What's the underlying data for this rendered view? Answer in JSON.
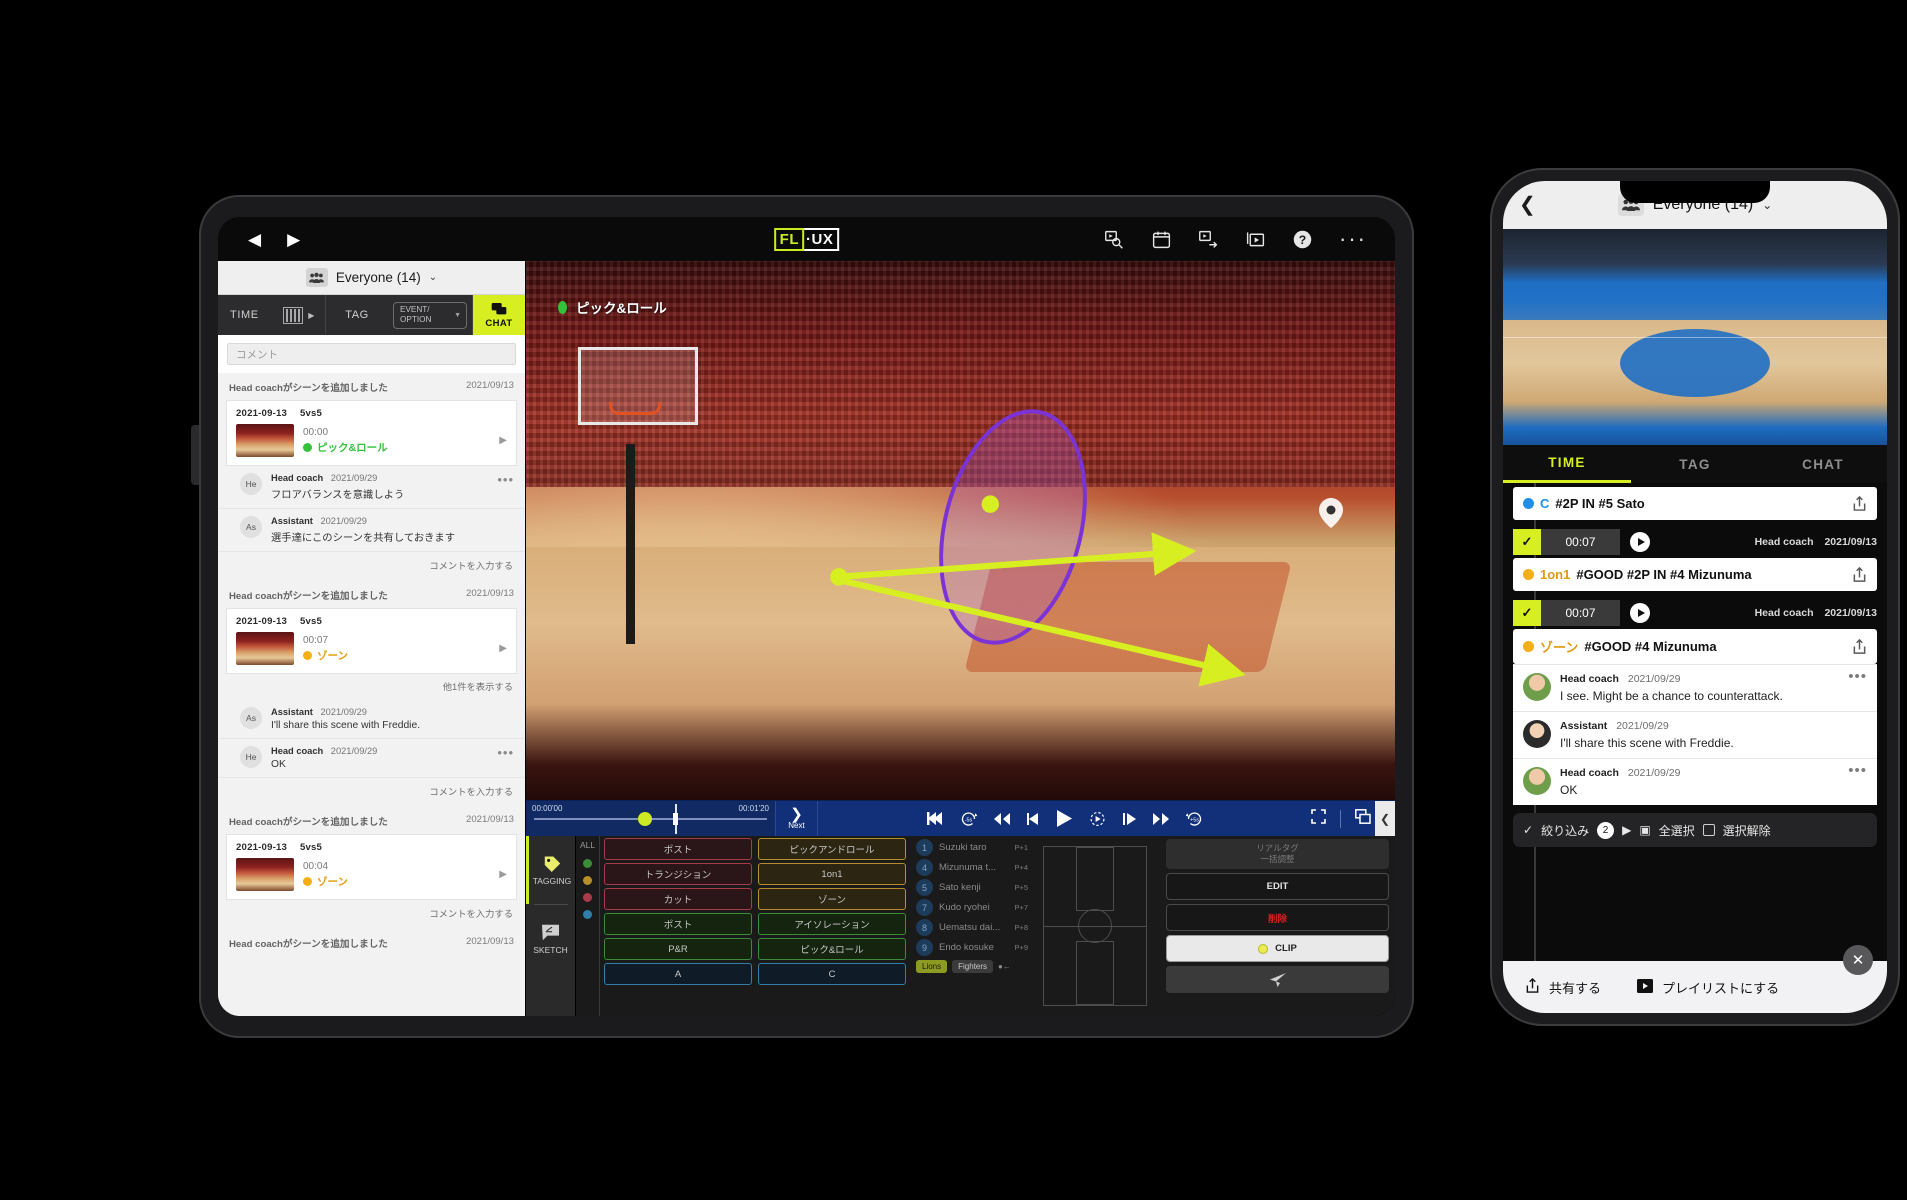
{
  "tablet": {
    "topbar": {
      "back_label": "◀",
      "forward_label": "▶",
      "logo_left": "FL",
      "logo_right": "·UX",
      "icons": [
        {
          "name": "video-search-icon",
          "glyph": "video-search"
        },
        {
          "name": "calendar-icon",
          "glyph": "calendar"
        },
        {
          "name": "video-export-icon",
          "glyph": "video-export"
        },
        {
          "name": "video-library-icon",
          "glyph": "video-library"
        },
        {
          "name": "help-icon",
          "glyph": "help"
        },
        {
          "name": "more-icon",
          "glyph": "···"
        }
      ]
    },
    "chat_panel": {
      "group_label": "Everyone (14)",
      "group_chevron": "⌄",
      "tabs": {
        "time": "TIME",
        "tag": "TAG",
        "event_option": "EVENT/\nOPTION",
        "event_option_line1": "EVENT/",
        "event_option_line2": "OPTION",
        "chat": "CHAT"
      },
      "comment_placeholder": "コメント",
      "link_label": "コメントを入力する",
      "show_more_label": "他1件を表示する",
      "groups": [
        {
          "system_text": "Head coachがシーンを追加しました",
          "system_date": "2021/09/13",
          "scene": {
            "date": "2021-09-13",
            "mode": "5vs5",
            "time": "00:00",
            "tag": "ピック&ロール",
            "color": "#35c23a"
          },
          "comments": [
            {
              "initials": "He",
              "author": "Head coach",
              "date": "2021/09/29",
              "text": "フロアバランスを意識しよう",
              "has_menu": true
            },
            {
              "initials": "As",
              "author": "Assistant",
              "date": "2021/09/29",
              "text": "選手達にこのシーンを共有しておきます",
              "has_menu": false
            }
          ],
          "footer_link": "コメントを入力する"
        },
        {
          "system_text": "Head coachがシーンを追加しました",
          "system_date": "2021/09/13",
          "scene": {
            "date": "2021-09-13",
            "mode": "5vs5",
            "time": "00:07",
            "tag": "ゾーン",
            "color": "#f5ae14"
          },
          "show_more": "他1件を表示する",
          "comments": [
            {
              "initials": "As",
              "author": "Assistant",
              "date": "2021/09/29",
              "text": "I'll share this scene with Freddie.",
              "has_menu": false
            },
            {
              "initials": "He",
              "author": "Head coach",
              "date": "2021/09/29",
              "text": "OK",
              "has_menu": true
            }
          ],
          "footer_link": "コメントを入力する"
        },
        {
          "system_text": "Head coachがシーンを追加しました",
          "system_date": "2021/09/13",
          "scene": {
            "date": "2021-09-13",
            "mode": "5vs5",
            "time": "00:04",
            "tag": "ゾーン",
            "color": "#f5ae14"
          },
          "footer_link": "コメントを入力する"
        },
        {
          "system_text": "Head coachがシーンを追加しました",
          "system_date": "2021/09/13"
        }
      ]
    },
    "video": {
      "scene_label": "ピック&ロール",
      "scene_color": "#35c23a",
      "annotation_color": "#7b33d6",
      "arrow_color": "#d7ef21"
    },
    "controls": {
      "start_time": "00:00'00",
      "end_time": "00:01'20",
      "next_label": "Next",
      "next_chevron": "❯",
      "buttons": [
        {
          "name": "skip-start-button",
          "label": "⏮"
        },
        {
          "name": "rewind-5s-button",
          "label": "-5s"
        },
        {
          "name": "rewind-button",
          "label": "◀◀"
        },
        {
          "name": "frame-back-button",
          "label": "◀|"
        },
        {
          "name": "play-button",
          "label": "▶"
        },
        {
          "name": "loop-button",
          "label": "↻"
        },
        {
          "name": "frame-forward-button",
          "label": "|▶"
        },
        {
          "name": "fast-forward-button",
          "label": "▶▶"
        },
        {
          "name": "forward-5s-button",
          "label": "+5s"
        }
      ],
      "fullscreen_label": "⛶",
      "pip_label": "❐",
      "collapse_label": "❮"
    },
    "tagging": {
      "side_items": [
        {
          "label": "TAGGING",
          "icon": "tag-icon",
          "active": true
        },
        {
          "label": "SKETCH",
          "icon": "sketch-icon",
          "active": false
        }
      ],
      "all_label": "ALL",
      "color_filters": [
        "#3c8c3a",
        "#b5902a",
        "#a93a4a",
        "#2f7fa8"
      ],
      "tag_rows": [
        {
          "left": "ポスト",
          "right": "ピックアンドロール",
          "left_color": "#a93a4a",
          "right_color": "#b5902a"
        },
        {
          "left": "トランジション",
          "right": "1on1",
          "left_color": "#a93a4a",
          "right_color": "#b5902a"
        },
        {
          "left": "カット",
          "right": "ゾーン",
          "left_color": "#a93a4a",
          "right_color": "#b5902a"
        },
        {
          "left": "ポスト",
          "right": "アイソレーション",
          "left_color": "#3c8c3a",
          "right_color": "#3c8c3a"
        },
        {
          "left": "P&R",
          "right": "ピック&ロール",
          "left_color": "#3c8c3a",
          "right_color": "#3c8c3a"
        },
        {
          "left": "A",
          "right": "C",
          "left_color": "#2f7fa8",
          "right_color": "#2f7fa8"
        }
      ],
      "players": [
        {
          "num": "1",
          "name": "Suzuki taro",
          "pt": "P+1"
        },
        {
          "num": "4",
          "name": "Mizunuma t...",
          "pt": "P+4"
        },
        {
          "num": "5",
          "name": "Sato kenji",
          "pt": "P+5"
        },
        {
          "num": "7",
          "name": "Kudo ryohei",
          "pt": "P+7"
        },
        {
          "num": "8",
          "name": "Uematsu dai...",
          "pt": "P+8"
        },
        {
          "num": "9",
          "name": "Endo kosuke",
          "pt": "P+9"
        }
      ],
      "teams": [
        {
          "label": "Lions",
          "color": "#8d9b22"
        },
        {
          "label": "Fighters",
          "color": "#4a4a4a"
        }
      ],
      "actions": {
        "realtag_line1": "リアルタグ",
        "realtag_line2": "一括調整",
        "edit": "EDIT",
        "delete": "削除",
        "clip": "CLIP",
        "send": "send-icon"
      }
    }
  },
  "phone": {
    "header": {
      "back": "❮",
      "title": "Everyone (14)",
      "chevron": "⌄"
    },
    "tabs": [
      {
        "label": "TIME",
        "active": true
      },
      {
        "label": "TAG",
        "active": false
      },
      {
        "label": "CHAT",
        "active": false
      }
    ],
    "timeline": [
      {
        "type": "card_only",
        "dot_color": "#1f8fe8",
        "keyword": "C",
        "keyword_color": "#1f8fe8",
        "title": "#2P IN #5 Sato"
      },
      {
        "type": "entry",
        "check": "✓",
        "time": "00:07",
        "author": "Head coach",
        "date": "2021/09/13",
        "dot_color": "#f5ae14",
        "keyword": "1on1",
        "keyword_color": "#e09a0e",
        "title": "#GOOD #2P IN #4 Mizunuma"
      },
      {
        "type": "entry",
        "check": "✓",
        "time": "00:07",
        "author": "Head coach",
        "date": "2021/09/13",
        "dot_color": "#f5ae14",
        "keyword": "ゾーン",
        "keyword_color": "#e09a0e",
        "title": "#GOOD #4 Mizunuma",
        "comments": [
          {
            "avatar": "m",
            "author": "Head coach",
            "date": "2021/09/29",
            "text": "I see. Might be a chance to counterattack.",
            "has_menu": true
          },
          {
            "avatar": "f",
            "author": "Assistant",
            "date": "2021/09/29",
            "text": "I'll share this scene with Freddie.",
            "has_menu": false
          },
          {
            "avatar": "m",
            "author": "Head coach",
            "date": "2021/09/29",
            "text": "OK",
            "has_menu": true
          }
        ]
      }
    ],
    "filter_bar": {
      "check": "✓",
      "label": "絞り込み",
      "count": "2",
      "select_all": "全選択",
      "deselect": "選択解除"
    },
    "bottom_bar": {
      "share": "共有する",
      "playlist": "プレイリストにする",
      "close": "✕"
    }
  }
}
